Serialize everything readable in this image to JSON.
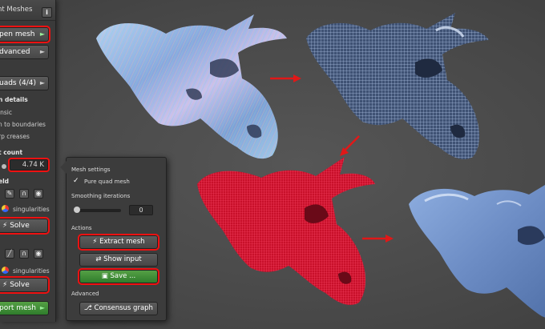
{
  "panel": {
    "title": "nt Meshes",
    "info_label": "i",
    "open_mesh": "pen mesh",
    "advanced": "dvanced",
    "quads": "uads (4/4)",
    "details_header": "n details",
    "opt_intrinsic": "insic",
    "opt_boundaries": "n to boundaries",
    "opt_creases": "rp creases",
    "count_header": "t count",
    "count_value": "4.74 K",
    "field_header": "eld",
    "singularities_1": "singularities",
    "solve_1": "Solve",
    "singularities_2": "singularities",
    "solve_2": "Solve",
    "export_mesh": "port mesh"
  },
  "popup": {
    "mesh_settings": "Mesh settings",
    "pure_quad": "Pure quad mesh",
    "smoothing": "Smoothing iterations",
    "smoothing_value": "0",
    "actions": "Actions",
    "extract_mesh": "Extract mesh",
    "show_input": "Show input",
    "save": "Save ...",
    "advanced": "Advanced",
    "consensus_graph": "Consensus graph"
  },
  "colors": {
    "highlight": "#e11111",
    "panel_bg": "#3a3a3a",
    "green_button": "#3c8c35",
    "viewport_bg": "#4b4b4b"
  }
}
